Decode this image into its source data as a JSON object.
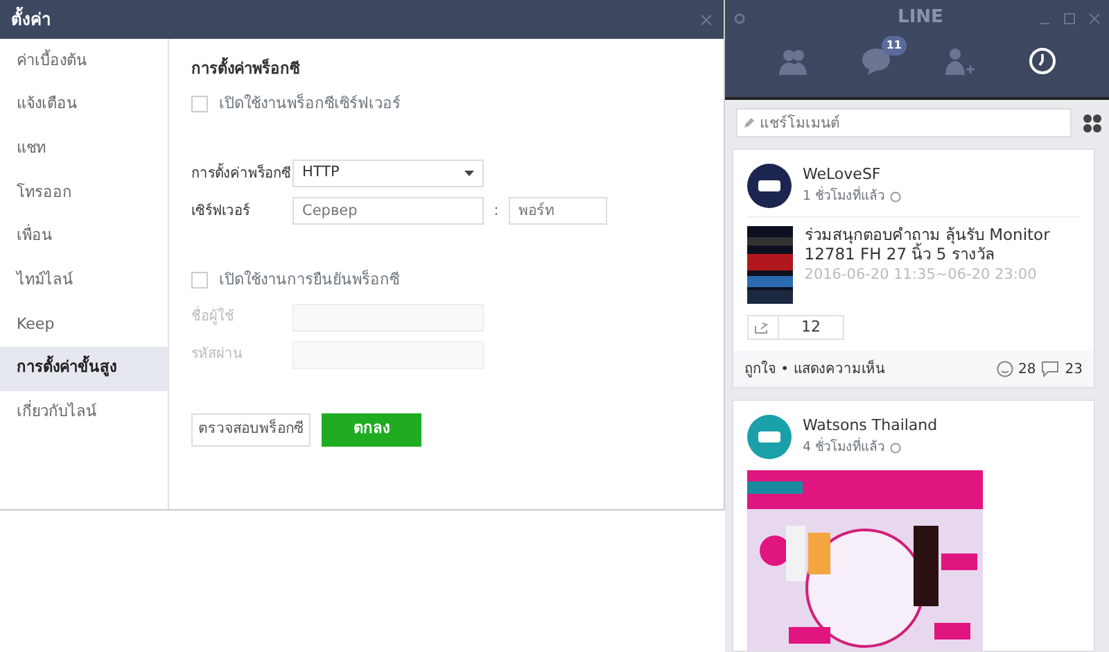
{
  "settings": {
    "title": "ตั้งค่า",
    "sidebar": {
      "items": [
        {
          "label": "ค่าเบื้องต้น",
          "selected": false
        },
        {
          "label": "แจ้งเตือน",
          "selected": false
        },
        {
          "label": "แชท",
          "selected": false
        },
        {
          "label": "โทรออก",
          "selected": false
        },
        {
          "label": "เพื่อน",
          "selected": false
        },
        {
          "label": "ไทม์ไลน์",
          "selected": false
        },
        {
          "label": "Keep",
          "selected": false
        },
        {
          "label": "การตั้งค่าขั้นสูง",
          "selected": true
        },
        {
          "label": "เกี่ยวกับไลน์",
          "selected": false
        }
      ]
    },
    "heading": "การตั้งค่าพร็อกซี",
    "proxy_checkbox": {
      "label": "เปิดใช้งานพร็อกซีเซิร์ฟเวอร์",
      "checked": false
    },
    "proxy_type": {
      "label": "การตั้งค่าพร็อกซี",
      "value": "HTTP"
    },
    "server": {
      "label": "เซิร์ฟเวอร์",
      "placeholder": "Сервер",
      "separator": ":",
      "port_placeholder": "พอร์ท"
    },
    "auth_checkbox": {
      "label": "เปิดใช้งานการยืนยันพร็อกซี",
      "checked": false
    },
    "username": {
      "label": "ชื่อผู้ใช้",
      "disabled": true
    },
    "password": {
      "label": "รหัสผ่าน",
      "disabled": true
    },
    "buttons": [
      {
        "label": "ตรวจสอบพร็อกซี",
        "kind": "secondary"
      },
      {
        "label": "ตกลง",
        "kind": "primary"
      }
    ]
  },
  "line": {
    "title": "LINE",
    "tabs": [
      {
        "kind": "friends",
        "selected": false
      },
      {
        "kind": "chats",
        "badge": "11",
        "selected": false
      },
      {
        "kind": "add",
        "selected": false
      },
      {
        "kind": "timeline",
        "selected": true
      }
    ],
    "share": {
      "placeholder": "แชร์โมเมนต์"
    },
    "posts": [
      {
        "author": "WeLoveSF",
        "time": "1 ชั่วโมงที่แล้ว",
        "color": "#1c2550",
        "text": "ร่วมสนุกตอบคำถาม ลุ้นรับ Monitor 12781 FH 27 นิ้ว 5 รางวัล",
        "dates": "2016-06-20 11:35~06-20 23:00",
        "shares": "12",
        "actions": "ถูกใจ • แสดงความเห็น",
        "likes": "28",
        "comments": "23"
      },
      {
        "author": "Watsons Thailand",
        "time": "4 ชั่วโมงที่แล้ว",
        "color": "#1aa0a8"
      }
    ]
  }
}
